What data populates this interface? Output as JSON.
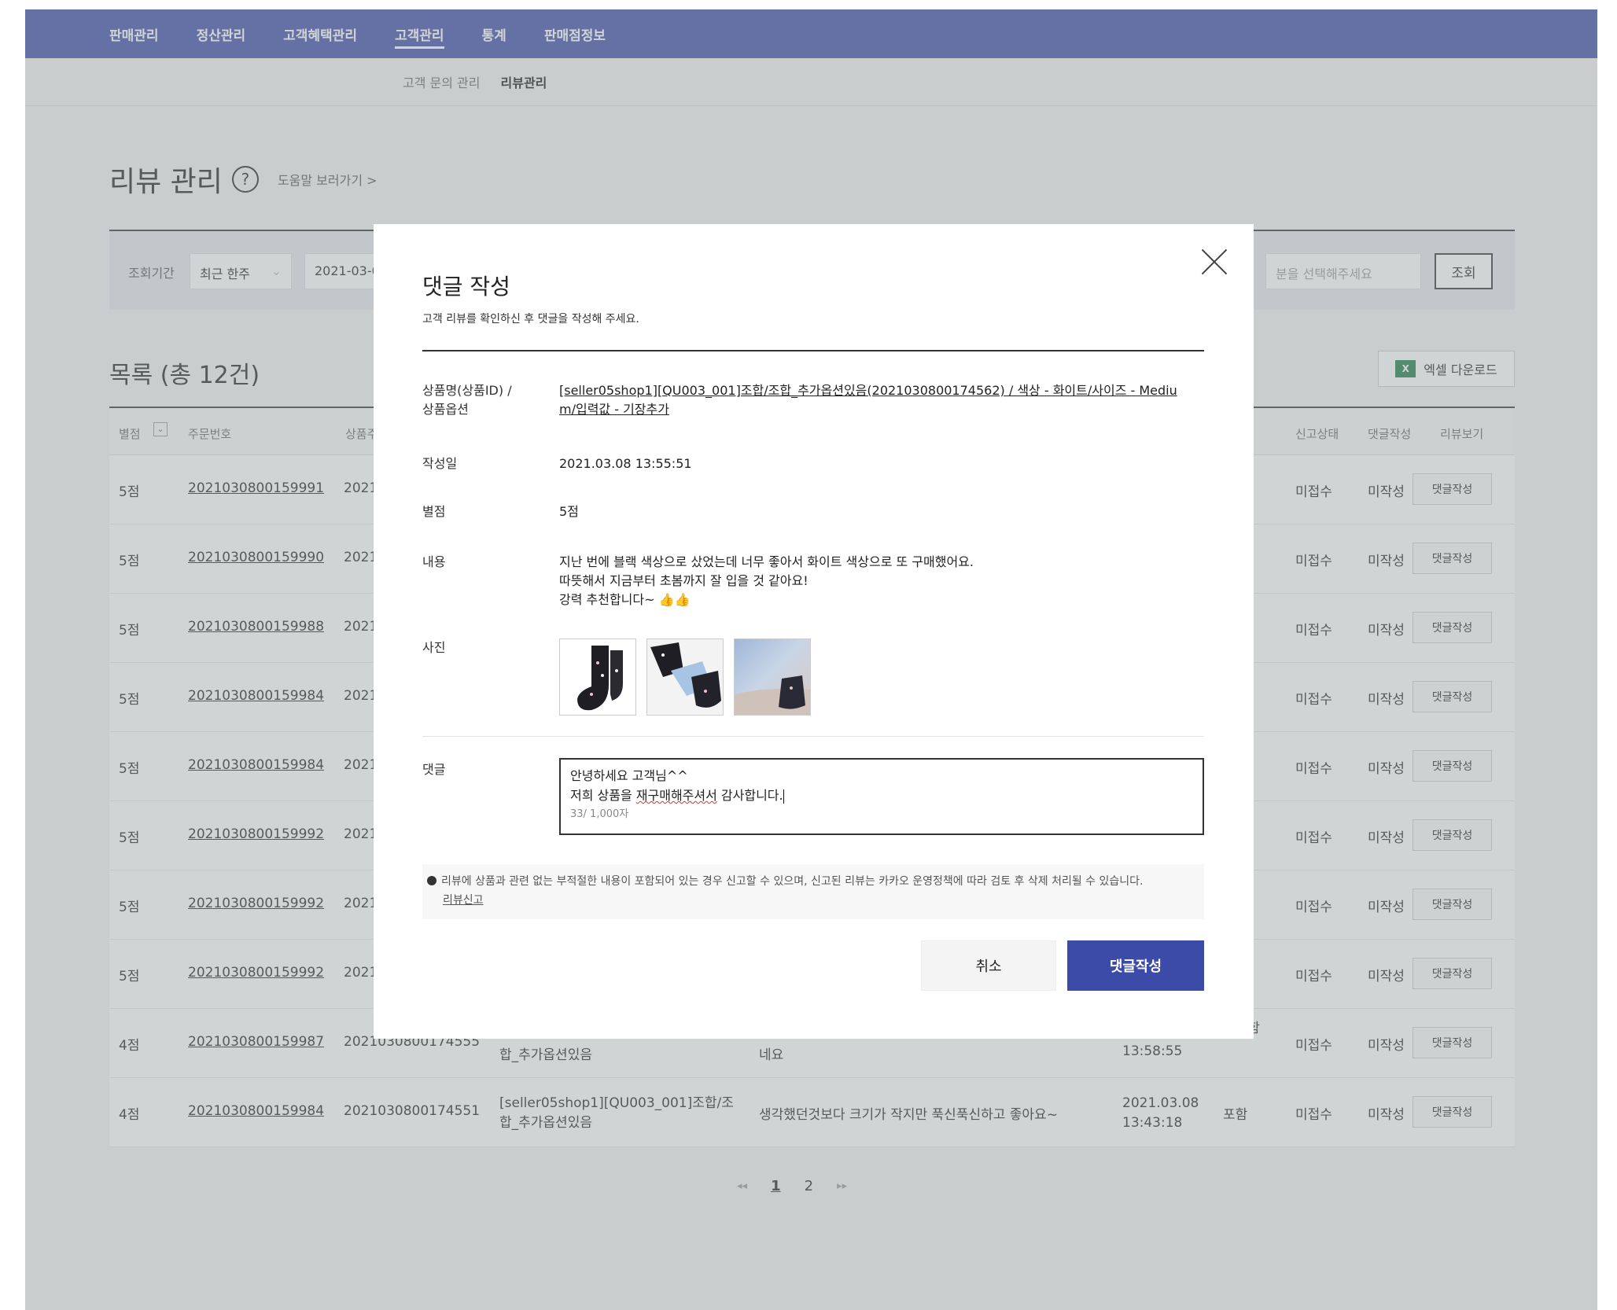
{
  "gnb": [
    "판매관리",
    "정산관리",
    "고객혜택관리",
    "고객관리",
    "통계",
    "판매점정보"
  ],
  "lnb": [
    "고객 문의 관리",
    "리뷰관리"
  ],
  "page": {
    "title": "리뷰 관리",
    "help_icon": "?",
    "help_link": "도움말 보러가기 >"
  },
  "filter": {
    "period_label": "조회기간",
    "period_value": "최근 한주",
    "date_value": "2021-03-0",
    "select_placeholder": "분을 선택해주세요",
    "search_label": "조회"
  },
  "list": {
    "title": "목록 (총 12건)",
    "excel_label": "엑셀 다운로드",
    "excel_icon": "X"
  },
  "table": {
    "headers": [
      "별점",
      "주문번호",
      "상품주",
      "신고상태",
      "댓글작성",
      "리뷰보기"
    ],
    "rows": [
      {
        "rating": "5점",
        "order": "2021030800159991",
        "product_id": "2021",
        "report": "미접수",
        "reply": "미작성",
        "btn": "댓글작성"
      },
      {
        "rating": "5점",
        "order": "2021030800159990",
        "product_id": "2021",
        "report": "미접수",
        "reply": "미작성",
        "btn": "댓글작성"
      },
      {
        "rating": "5점",
        "order": "2021030800159988",
        "product_id": "2021",
        "report": "미접수",
        "reply": "미작성",
        "btn": "댓글작성"
      },
      {
        "rating": "5점",
        "order": "2021030800159984",
        "product_id": "2021",
        "report": "미접수",
        "reply": "미작성",
        "btn": "댓글작성"
      },
      {
        "rating": "5점",
        "order": "2021030800159984",
        "product_id": "2021",
        "report": "미접수",
        "reply": "미작성",
        "btn": "댓글작성"
      },
      {
        "rating": "5점",
        "order": "2021030800159992",
        "product_id": "2021",
        "report": "미접수",
        "reply": "미작성",
        "btn": "댓글작성"
      },
      {
        "rating": "5점",
        "order": "2021030800159992",
        "product_id": "2021",
        "report": "미접수",
        "reply": "미작성",
        "btn": "댓글작성"
      },
      {
        "rating": "5점",
        "order": "2021030800159992",
        "product_id": "2021",
        "report": "미접수",
        "reply": "미작성",
        "btn": "댓글작성"
      },
      {
        "rating": "4점",
        "order": "2021030800159987",
        "product_id": "2021030800174555",
        "product_name": "합_추가옵션있음",
        "content": "네요",
        "time": "13:58:55",
        "photo": "미포함",
        "report": "미접수",
        "reply": "미작성",
        "btn": "댓글작성"
      },
      {
        "rating": "4점",
        "order": "2021030800159984",
        "product_id": "2021030800174551",
        "product_name_1": "[seller05shop1][QU003_001]조합/조",
        "product_name_2": "합_추가옵션있음",
        "content": "생각했던것보다 크기가 작지만 푹신푹신하고 좋아요~",
        "date": "2021.03.08",
        "time": "13:43:18",
        "photo": "포함",
        "report": "미접수",
        "reply": "미작성",
        "btn": "댓글작성"
      }
    ]
  },
  "pager": {
    "first": "◂◂",
    "pages": [
      "1",
      "2"
    ],
    "last": "▸▸"
  },
  "modal": {
    "title": "댓글 작성",
    "desc": "고객 리뷰를 확인하신 후 댓글을 작성해 주세요.",
    "product_label_1": "상품명(상품ID) /",
    "product_label_2": "상품옵션",
    "product_value_1": "[seller05shop1][QU003_001]조합/조합_추가옵션있음(2021030800174562) / 색상 - 화이트/사이즈 - Mediu",
    "product_value_2": "m/입력값 - 기장추가",
    "date_label": "작성일",
    "date_value": "2021.03.08 13:55:51",
    "rating_label": "별점",
    "rating_value": "5점",
    "content_label": "내용",
    "content_1": "지난 번에 블랙 색상으로 샀었는데 너무 좋아서 화이트 색상으로 또 구매했어요.",
    "content_2": "따뜻해서 지금부터 초봄까지 잘 입을 것 같아요!",
    "content_3": "강력 추천합니다~ 👍👍",
    "photo_label": "사진",
    "reply_label": "댓글",
    "reply_line1": "안녕하세요 고객님^^",
    "reply_line2_a": "저희 상품을 ",
    "reply_line2_b": "재구매해주셔서",
    "reply_line2_c": " 감사합니다.",
    "reply_count": "33/ 1,000자",
    "notice": "리뷰에 상품과 관련 없는 부적절한 내용이 포함되어 있는 경우 신고할 수 있으며, 신고된 리뷰는 카카오 운영정책에 따라 검토 후 삭제 처리될 수 있습니다.",
    "report_link": "리뷰신고",
    "cancel_label": "취소",
    "submit_label": "댓글작성"
  }
}
